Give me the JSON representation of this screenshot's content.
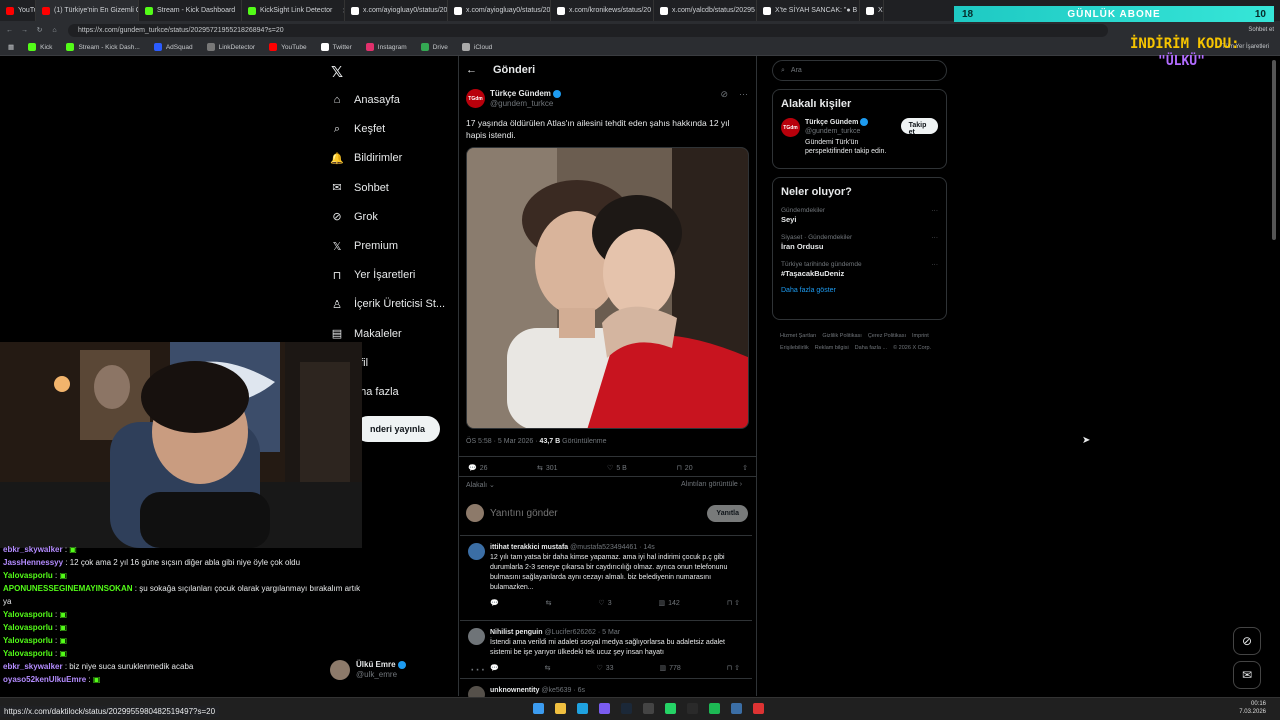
{
  "browser": {
    "tabs": [
      {
        "label": "YouTube",
        "color": "#ff0000"
      },
      {
        "label": "(1) Türkiye'nin En Gizemli C",
        "color": "#ff0000"
      },
      {
        "label": "Stream - Kick Dashboard",
        "color": "#53fc18"
      },
      {
        "label": "KickSight Link Detector",
        "color": "#53fc18"
      },
      {
        "label": "x.com/ayiogluay0/status/20",
        "color": "#ffffff"
      },
      {
        "label": "x.com/ayiogluay0/status/20",
        "color": "#ffffff"
      },
      {
        "label": "x.com/kronikews/status/20",
        "color": "#ffffff"
      },
      {
        "label": "x.com/yalcdb/status/20295",
        "color": "#ffffff"
      },
      {
        "label": "X'te SİYAH SANCAK: \"● B",
        "color": "#ffffff"
      },
      {
        "label": "X",
        "color": "#ffffff"
      }
    ],
    "url": "https://x.com/gundem_turkce/status/2029572195521826894?s=20",
    "bookmarks": [
      "Kick",
      "Stream - Kick Dash...",
      "AdSquad",
      "LinkDetector",
      "YouTube",
      "Twitter",
      "Instagram",
      "Drive",
      "iCloud"
    ],
    "right_labels": {
      "chat": "Sohbet et",
      "all": "Tüm Yer İşaretleri"
    },
    "status_url": "https://x.com/daktilock/status/2029955980482519497?s=20"
  },
  "overlay": {
    "abone_left": "18",
    "abone_title": "GÜNLÜK ABONE",
    "abone_right": "10",
    "indirim": "İNDİRİM KODU:",
    "kod": "\"ÜLKÜ\""
  },
  "nav": {
    "items": [
      {
        "label": "Anasayfa",
        "icon": "home-icon"
      },
      {
        "label": "Keşfet",
        "icon": "search-icon"
      },
      {
        "label": "Bildirimler",
        "icon": "bell-icon"
      },
      {
        "label": "Sohbet",
        "icon": "mail-icon"
      },
      {
        "label": "Grok",
        "icon": "grok-icon"
      },
      {
        "label": "Premium",
        "icon": "x-icon"
      },
      {
        "label": "Yer İşaretleri",
        "icon": "bookmark-icon"
      },
      {
        "label": "İçerik Üreticisi St...",
        "icon": "creator-icon"
      },
      {
        "label": "Makaleler",
        "icon": "article-icon"
      },
      {
        "label": "ofil",
        "icon": "user-icon"
      },
      {
        "label": "aha fazla",
        "icon": "more-icon"
      }
    ],
    "post_button": "nderi yayınla",
    "me": {
      "name": "Ülkü Emre",
      "handle": "@ulk_emre"
    }
  },
  "post": {
    "header": "Gönderi",
    "author": "Türkçe Gündem",
    "handle": "@gundem_turkce",
    "avatar_text": "TGdm",
    "text": "17 yaşında öldürülen Atlas'ın ailesini tehdit eden şahıs hakkında 12 yıl hapis istendi.",
    "time": "ÖS 5:58 · 5 Mar 2026 ·",
    "views": "43,7 B",
    "views_label": "Görüntülenme",
    "stats": {
      "replies": "26",
      "reposts": "301",
      "likes": "5 B",
      "bookmarks": "20"
    },
    "related": "Alakalı",
    "quotes": "Alıntıları görüntüle",
    "reply_placeholder": "Yanıtını gönder",
    "reply_button": "Yanıtla"
  },
  "replies": [
    {
      "name": "ittihat terakkici mustafa",
      "handle": "@mustafa523494461 · 14s",
      "text": "12 yılı tam yatsa bir daha kimse yapamaz. ama iyi hal indirimi çocuk p.ç gibi durumlarla 2-3 seneye çıkarsa bir caydırıcılığı olmaz. ayrıca onun telefonunu bulmasını sağlayanlarda aynı cezayı almalı. biz belediyenin numarasını bulamazken...",
      "reposts": "",
      "likes": "3",
      "views": "142",
      "color": "#3b6ea5"
    },
    {
      "name": "Nihilist penguin",
      "handle": "@Lucifer626262 · 5 Mar",
      "text": "İstendi ama verildi mi adaleti sosyal medya sağlıyorlarsa bu adaletsiz adalet sistemi be işe yarıyor ülkedeki tek ucuz şey insan hayatı",
      "reposts": "",
      "likes": "33",
      "views": "778",
      "color": "#6f7478"
    },
    {
      "name": "unknownentity",
      "handle": "@ke5639 · 6s",
      "text": "",
      "reposts": "",
      "likes": "",
      "views": "",
      "color": "#55504a"
    }
  ],
  "sidebar": {
    "search_placeholder": "Ara",
    "people_title": "Alakalı kişiler",
    "person": {
      "name": "Türkçe Gündem",
      "handle": "@gundem_turkce",
      "bio": "Gündemi Türk'ün perspektifinden takip edin.",
      "follow": "Takip et"
    },
    "trends_title": "Neler oluyor?",
    "trends": [
      {
        "context": "Gündemdekiler",
        "name": "Seyi"
      },
      {
        "context": "Siyaset · Gündemdekiler",
        "name": "İran Ordusu"
      },
      {
        "context": "Türkiye tarihinde gündemde",
        "name": "#TaşacakBuDeniz"
      }
    ],
    "show_more": "Daha fazla göster",
    "footer": [
      "Hizmet Şartları",
      "Gizlilik Politikası",
      "Çerez Politikası",
      "Imprint",
      "Erişilebilirlik",
      "Reklam bilgisi",
      "Daha fazla ...",
      "© 2026 X Corp."
    ]
  },
  "chat": [
    {
      "user": "ebkr_skywalker",
      "msg": "",
      "color": "#b48cff"
    },
    {
      "user": "JassHennessyy",
      "msg": "12 çok ama 2 yıl 16 güne sıçsın diğer abla gibi niye öyle çok oldu",
      "color": "#b48cff"
    },
    {
      "user": "Yalovasporlu",
      "msg": "",
      "color": "#53fc18"
    },
    {
      "user": "APONUNESSEGINEMAYINSOKAN",
      "msg": "şu sokağa sıçılanları çocuk olarak yargılanmayı bırakalım artık ya",
      "color": "#53fc18"
    },
    {
      "user": "Yalovasporlu",
      "msg": "",
      "color": "#53fc18"
    },
    {
      "user": "Yalovasporlu",
      "msg": "",
      "color": "#53fc18"
    },
    {
      "user": "Yalovasporlu",
      "msg": "",
      "color": "#53fc18"
    },
    {
      "user": "Yalovasporlu",
      "msg": "",
      "color": "#53fc18"
    },
    {
      "user": "ebkr_skywalker",
      "msg": "biz niye suca suruklenmedik acaba",
      "color": "#b48cff"
    },
    {
      "user": "oyaso52kenUlkuEmre",
      "msg": "",
      "color": "#b48cff"
    }
  ],
  "taskbar": {
    "time": "00:16",
    "date": "7.03.2026"
  }
}
